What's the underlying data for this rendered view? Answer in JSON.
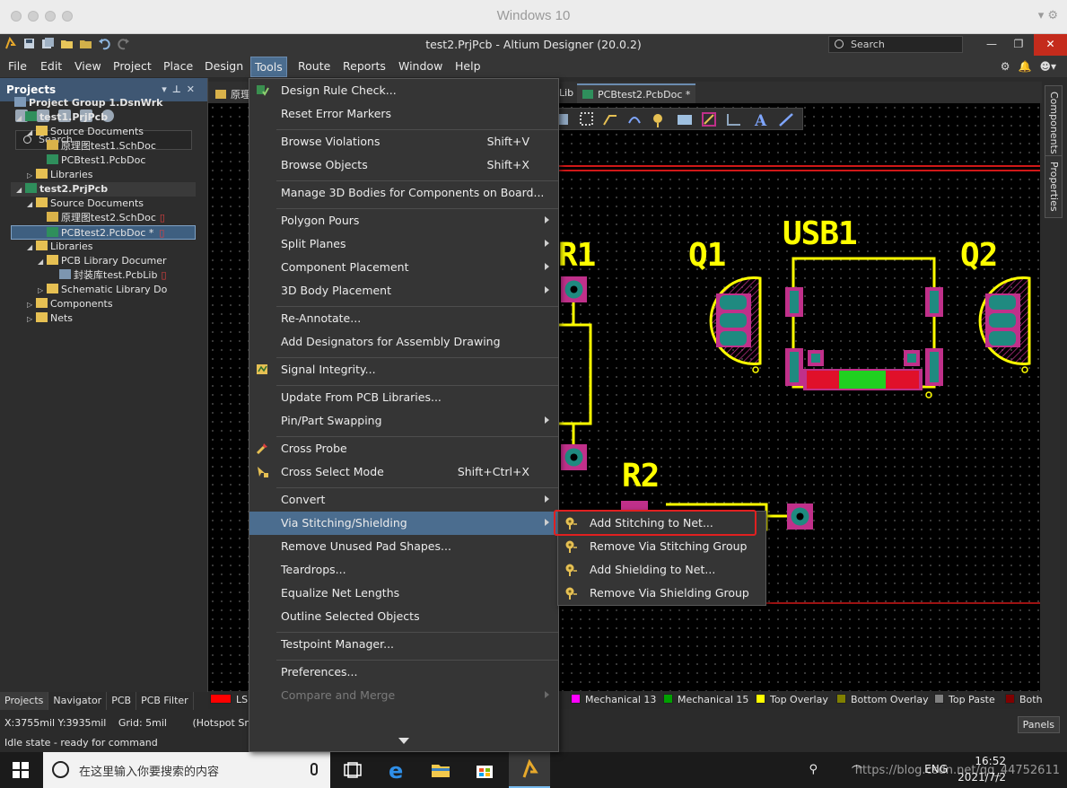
{
  "os_window": {
    "title": "Windows 10"
  },
  "app": {
    "title": "test2.PrjPcb - Altium Designer (20.0.2)",
    "search_placeholder": "Search",
    "menus": [
      "File",
      "Edit",
      "View",
      "Project",
      "Place",
      "Design",
      "Tools",
      "Route",
      "Reports",
      "Window",
      "Help"
    ]
  },
  "projects_panel": {
    "title": "Projects",
    "search_placeholder": "Search",
    "tree": [
      {
        "label": "Project Group 1.DsnWrk"
      },
      {
        "label": "test1.PrjPcb"
      },
      {
        "label": "Source Documents"
      },
      {
        "label": "原理图test1.SchDoc"
      },
      {
        "label": "PCBtest1.PcbDoc"
      },
      {
        "label": "Libraries"
      },
      {
        "label": "test2.PrjPcb"
      },
      {
        "label": "Source Documents"
      },
      {
        "label": "原理图test2.SchDoc"
      },
      {
        "label": "PCBtest2.PcbDoc *"
      },
      {
        "label": "Libraries"
      },
      {
        "label": "PCB Library Documer"
      },
      {
        "label": "封装库test.PcbLib"
      },
      {
        "label": "Schematic Library Do"
      },
      {
        "label": "Components"
      },
      {
        "label": "Nets"
      }
    ],
    "bottom_tabs": [
      "Projects",
      "Navigator",
      "PCB",
      "PCB Filter"
    ]
  },
  "doc_tabs": {
    "tab1": "原理",
    "tab2": "Lib",
    "tab3": "PCBtest2.PcbDoc *"
  },
  "right_rail": [
    "Components",
    "Properties"
  ],
  "pcb": {
    "labels": [
      "R1",
      "Q1",
      "USB1",
      "Q2",
      "R2"
    ]
  },
  "tools_menu": {
    "items": [
      {
        "label": "Design Rule Check...",
        "shortcut": ""
      },
      {
        "label": "Reset Error Markers",
        "shortcut": ""
      },
      {
        "label": "Browse Violations",
        "shortcut": "Shift+V"
      },
      {
        "label": "Browse Objects",
        "shortcut": "Shift+X"
      },
      {
        "label": "Manage 3D Bodies for Components on Board...",
        "shortcut": ""
      },
      {
        "label": "Polygon Pours",
        "shortcut": ""
      },
      {
        "label": "Split Planes",
        "shortcut": ""
      },
      {
        "label": "Component Placement",
        "shortcut": ""
      },
      {
        "label": "3D Body Placement",
        "shortcut": ""
      },
      {
        "label": "Re-Annotate...",
        "shortcut": ""
      },
      {
        "label": "Add Designators for Assembly Drawing",
        "shortcut": ""
      },
      {
        "label": "Signal Integrity...",
        "shortcut": ""
      },
      {
        "label": "Update From PCB Libraries...",
        "shortcut": ""
      },
      {
        "label": "Pin/Part Swapping",
        "shortcut": ""
      },
      {
        "label": "Cross Probe",
        "shortcut": ""
      },
      {
        "label": "Cross Select Mode",
        "shortcut": "Shift+Ctrl+X"
      },
      {
        "label": "Convert",
        "shortcut": ""
      },
      {
        "label": "Via Stitching/Shielding",
        "shortcut": ""
      },
      {
        "label": "Remove Unused Pad Shapes...",
        "shortcut": ""
      },
      {
        "label": "Teardrops...",
        "shortcut": ""
      },
      {
        "label": "Equalize Net Lengths",
        "shortcut": ""
      },
      {
        "label": "Outline Selected Objects",
        "shortcut": ""
      },
      {
        "label": "Testpoint Manager...",
        "shortcut": ""
      },
      {
        "label": "Preferences...",
        "shortcut": ""
      },
      {
        "label": "Compare and Merge",
        "shortcut": ""
      }
    ]
  },
  "via_submenu": {
    "items": [
      "Add Stitching to Net...",
      "Remove Via Stitching Group",
      "Add Shielding to Net...",
      "Remove Via Shielding Group"
    ]
  },
  "layer_tabs": [
    {
      "label": "LS",
      "color": "#ff0000"
    },
    {
      "label": "Mechanical 13",
      "color": "#ff00ff"
    },
    {
      "label": "Mechanical 15",
      "color": "#00a000"
    },
    {
      "label": "Top Overlay",
      "color": "#ffff00"
    },
    {
      "label": "Bottom Overlay",
      "color": "#808000"
    },
    {
      "label": "Top Paste",
      "color": "#808080"
    },
    {
      "label": "Both",
      "color": "#800000"
    }
  ],
  "status": {
    "coords": "X:3755mil Y:3935mil",
    "grid": "Grid: 5mil",
    "snap": "(Hotspot Snap)",
    "state": "Idle state - ready for command",
    "panels": "Panels"
  },
  "taskbar": {
    "search_placeholder": "在这里输入你要搜索的内容",
    "time": "16:52",
    "date": "2021/7/2",
    "lang": "ENG",
    "watermark": "https://blog.csdn.net/qq_44752611"
  },
  "colors": {
    "menu_highlight": "#4b6d8f",
    "overlay": "#ffff00",
    "pad_outline": "#c0308a",
    "callout": "#e02020"
  }
}
